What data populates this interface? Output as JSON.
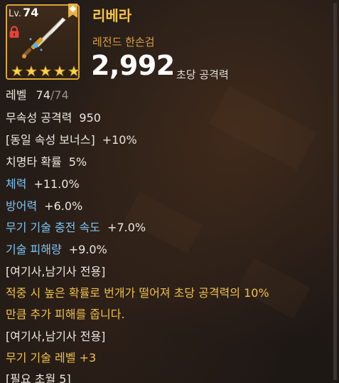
{
  "item": {
    "level_prefix": "Lv.",
    "level": "74",
    "name": "리베라",
    "type": "레전드 한손검",
    "power": "2,992",
    "power_label": "초당 공격력",
    "stars": 5
  },
  "stats": [
    {
      "label": "레벨",
      "value": "74",
      "suffix": "/74"
    },
    {
      "label": "무속성 공격력",
      "value": "950"
    },
    {
      "label": "[동일 속성 보너스]",
      "value": "+10%"
    },
    {
      "label": "치명타 확률",
      "value": "5%"
    },
    {
      "label": "체력",
      "value": "+11.0%"
    },
    {
      "label": "방어력",
      "value": "+6.0%"
    },
    {
      "label": "무기 기술 충전 속도",
      "value": "+7.0%"
    },
    {
      "label": "기술 피해량",
      "value": "+9.0%"
    }
  ],
  "effect": {
    "restriction_1": "[여기사,남기사 전용]",
    "desc_line1": "적중 시 높은 확률로 번개가 떨어져 초당 공격력의 10%",
    "desc_line2": "만큼 추가 피해를 줍니다.",
    "restriction_2": "[여기사,남기사 전용]",
    "skill_level": "무기 기술 레벨 +3",
    "requirement": "[필요 초월 5]"
  },
  "colors": {
    "frame_gold": "#d8a63b",
    "name_gold": "#f5c44b",
    "stat_blue": "#7cc5f2",
    "lock_red": "#e2433a"
  },
  "icons": [
    "bookmark-icon",
    "lock-icon",
    "sword-icon",
    "star-icon"
  ]
}
